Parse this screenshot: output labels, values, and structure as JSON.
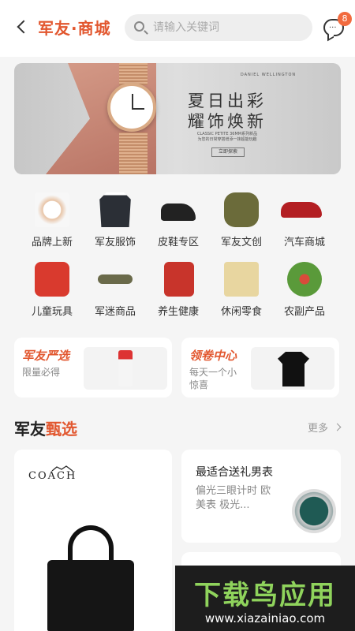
{
  "header": {
    "brand": "军友·商城",
    "search_placeholder": "请输入关键词",
    "message_badge": "8"
  },
  "banner": {
    "brand_line": "DANIEL WELLINGTON",
    "title_line1": "夏日出彩",
    "title_line2": "耀饰焕新",
    "sub_line1": "CLASSIC PETITE 36MM系列新品",
    "sub_line2": "为您的日常穿搭增添一抹超能玩趣",
    "cta": "立即探索"
  },
  "categories": [
    {
      "label": "品牌上新",
      "icon": "watch-icon",
      "color": "#e8c4a6"
    },
    {
      "label": "军友服饰",
      "icon": "suit-icon",
      "color": "#2b2f36"
    },
    {
      "label": "皮鞋专区",
      "icon": "shoe-icon",
      "color": "#222222"
    },
    {
      "label": "军友文创",
      "icon": "canteen-icon",
      "color": "#6b6b3a"
    },
    {
      "label": "汽车商城",
      "icon": "car-icon",
      "color": "#b31e22"
    },
    {
      "label": "儿童玩具",
      "icon": "robot-toy-icon",
      "color": "#d93a2e"
    },
    {
      "label": "军迷商品",
      "icon": "plane-model-icon",
      "color": "#6a6a4a"
    },
    {
      "label": "养生健康",
      "icon": "tea-can-icon",
      "color": "#c8342b"
    },
    {
      "label": "休闲零食",
      "icon": "snack-bag-icon",
      "color": "#e8d6a0"
    },
    {
      "label": "农副产品",
      "icon": "vegetables-icon",
      "color": "#5a9a3a"
    }
  ],
  "promos": [
    {
      "title": "军友严选",
      "desc": "限量必得",
      "icon": "liquor-bottle-icon"
    },
    {
      "title": "领卷中心",
      "desc": "每天一个小惊喜",
      "icon": "tshirt-icon"
    }
  ],
  "section": {
    "title_a": "军友",
    "title_b": "甄选",
    "title_c": "",
    "more": "更多"
  },
  "featured": {
    "big_brand": "COACH",
    "small_title": "最适合送礼男表",
    "small_desc": "偏光三眼计时 欧美表 极光..."
  },
  "watermark": {
    "title": "下载鸟应用",
    "url": "www.xiazainiao.com"
  },
  "colors": {
    "accent": "#e2572f",
    "badge": "#f26b3f",
    "background": "#f5f5f5"
  }
}
